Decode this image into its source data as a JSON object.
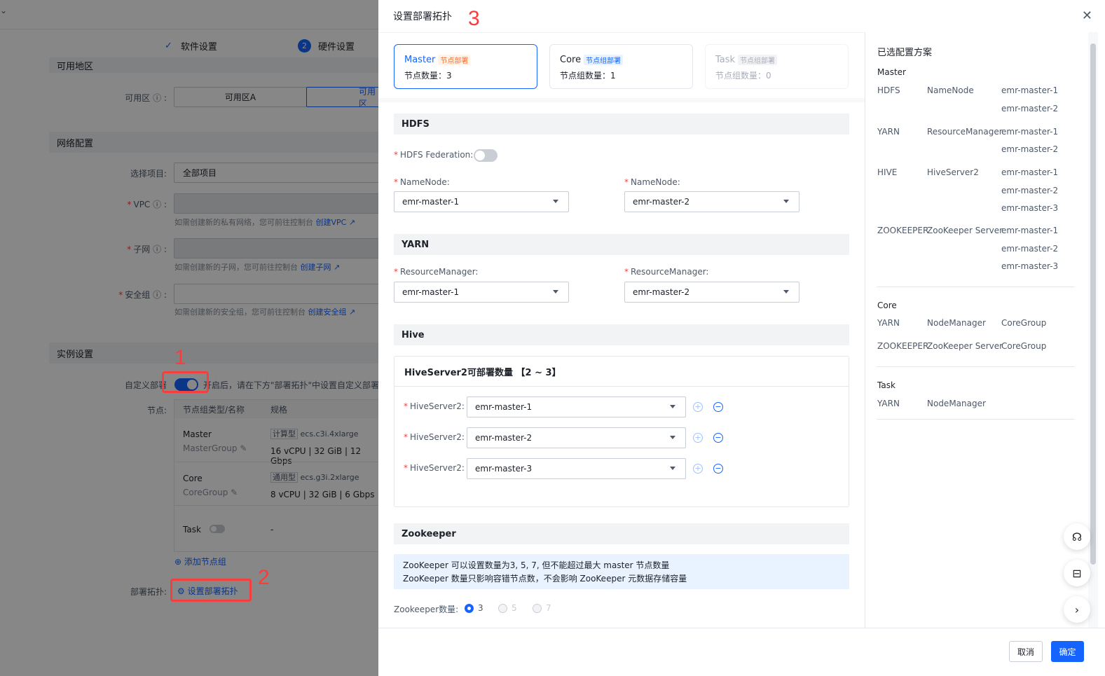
{
  "background": {
    "steps": [
      {
        "label": "软件设置"
      },
      {
        "num": "2",
        "label": "硬件设置"
      }
    ],
    "section_az": "可用地区",
    "az_label": "可用区",
    "az_options": [
      "可用区A",
      "可用区"
    ],
    "section_net": "网络配置",
    "project_label": "选择项目:",
    "project_value": "全部项目",
    "vpc_label": "VPC",
    "vpc_hint": "如需创建新的私有网络，您可前往控制台",
    "vpc_link": "创建VPC",
    "subnet_label": "子网",
    "subnet_hint": "如需创建新的子网，您可前往控制台",
    "subnet_link": "创建子网",
    "sg_label": "安全组",
    "sg_hint": "如需创建新的安全组，您可前往控制台",
    "sg_link": "创建安全组",
    "section_inst": "实例设置",
    "custom_label": "自定义部署",
    "custom_hint": "开启后，请在下方\"部署拓扑\"中设置自定义部署方",
    "node_label": "节点:",
    "table_headers": [
      "节点组类型/名称",
      "规格"
    ],
    "rows": [
      {
        "name": "Master",
        "group": "MasterGroup",
        "tag": "计算型",
        "spec_type": "ecs.c3i.4xlarge",
        "spec": "16 vCPU | 32 GiB | 12 Gbps"
      },
      {
        "name": "Core",
        "group": "CoreGroup",
        "tag": "通用型",
        "spec_type": "ecs.g3i.2xlarge",
        "spec": "8 vCPU | 32 GiB | 6 Gbps"
      },
      {
        "name": "Task",
        "spec": "-"
      }
    ],
    "add_group": "添加节点组",
    "topo_label": "部署拓扑:",
    "topo_button": "设置部署拓扑"
  },
  "annotations": [
    "1",
    "2",
    "3"
  ],
  "drawer": {
    "title": "设置部署拓扑",
    "tabs": [
      {
        "name": "Master",
        "tag": "节点部署",
        "count_label": "节点数量：3"
      },
      {
        "name": "Core",
        "tag": "节点组部署",
        "count_label": "节点组数量：1"
      },
      {
        "name": "Task",
        "tag": "节点组部署",
        "count_label": "节点组数量：0"
      }
    ],
    "hdfs": {
      "title": "HDFS",
      "federation_label": "HDFS Federation:",
      "nn_label": "NameNode:",
      "nn1": "emr-master-1",
      "nn2": "emr-master-2"
    },
    "yarn": {
      "title": "YARN",
      "rm_label": "ResourceManager:",
      "rm1": "emr-master-1",
      "rm2": "emr-master-2"
    },
    "hive": {
      "title": "Hive",
      "box_title": "HiveServer2可部署数量 【2 ~ 3】",
      "hs_label": "HiveServer2:",
      "values": [
        "emr-master-1",
        "emr-master-2",
        "emr-master-3"
      ]
    },
    "zk": {
      "title": "Zookeeper",
      "info1": "ZooKeeper 可以设置数量为3, 5, 7, 但不能超过最大 master 节点数量",
      "info2": "ZooKeeper 数量只影响容错节点数，不会影响 ZooKeeper 元数据存储容量",
      "count_label": "Zookeeper数量:",
      "options": [
        "3",
        "5",
        "7"
      ]
    },
    "summary": {
      "title": "已选配置方案",
      "master": "Master",
      "master_rows": [
        {
          "svc": "HDFS",
          "comp": "NameNode",
          "nodes": [
            "emr-master-1",
            "emr-master-2"
          ]
        },
        {
          "svc": "YARN",
          "comp": "ResourceManager",
          "nodes": [
            "emr-master-1",
            "emr-master-2"
          ]
        },
        {
          "svc": "HIVE",
          "comp": "HiveServer2",
          "nodes": [
            "emr-master-1",
            "emr-master-2",
            "emr-master-3"
          ]
        },
        {
          "svc": "ZOOKEEPER",
          "comp": "ZooKeeper Server",
          "nodes": [
            "emr-master-1",
            "emr-master-2",
            "emr-master-3"
          ]
        }
      ],
      "core": "Core",
      "core_rows": [
        {
          "svc": "YARN",
          "comp": "NodeManager",
          "group": "CoreGroup"
        },
        {
          "svc": "ZOOKEEPER",
          "comp": "ZooKeeper Server",
          "group": "CoreGroup"
        }
      ],
      "task": "Task",
      "task_rows": [
        {
          "svc": "YARN",
          "comp": "NodeManager"
        }
      ]
    },
    "cancel": "取消",
    "confirm": "确定"
  }
}
